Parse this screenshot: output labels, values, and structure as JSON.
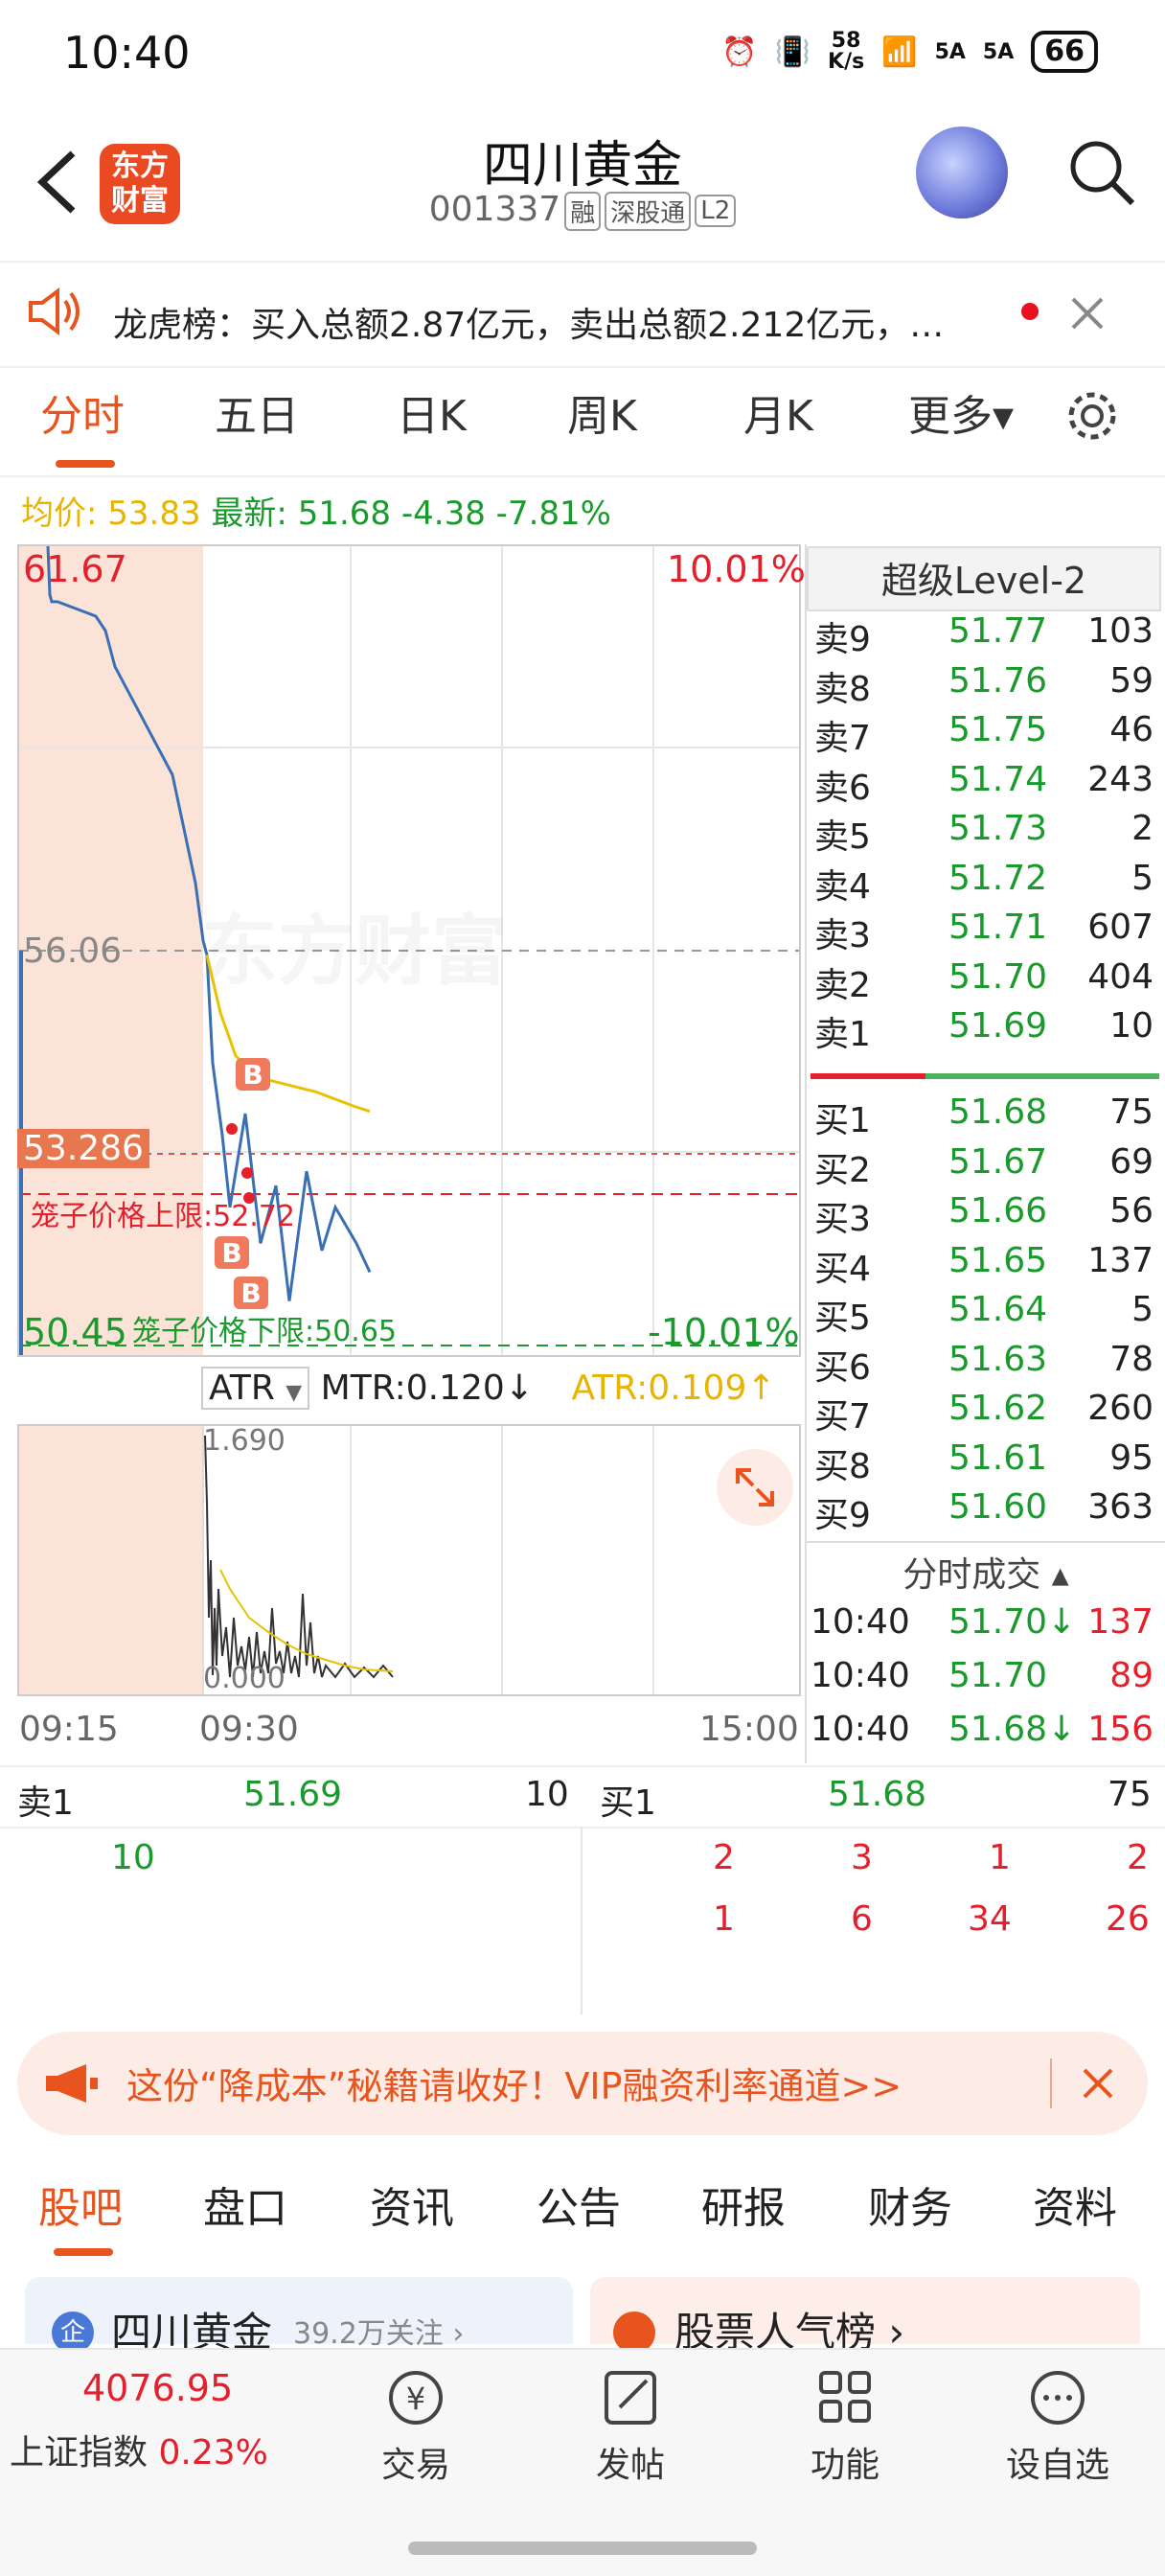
{
  "status_bar": {
    "time": "10:40",
    "net_speed": "58\nK/s",
    "signal1": "5A",
    "signal2": "5A",
    "battery": "66"
  },
  "header": {
    "logo": "东方\n财富",
    "title": "四川黄金",
    "code": "001337",
    "tags": [
      "融",
      "深股通",
      "L2"
    ]
  },
  "notice": {
    "text": "龙虎榜：买入总额2.87亿元，卖出总额2.212亿元，…"
  },
  "tabs": [
    "分时",
    "五日",
    "日K",
    "周K",
    "月K",
    "更多▾"
  ],
  "price_info": {
    "avg_label": "均价:",
    "avg_value": "53.83",
    "latest_label": "最新:",
    "latest_value": "51.68",
    "change": "-4.38",
    "pct": "-7.81%"
  },
  "chart": {
    "max_label": "61.67",
    "max_pct": "10.01%",
    "prev_close": "56.06",
    "current_label": "53.286",
    "min_label": "50.45",
    "min_pct": "-10.01%",
    "cage_upper": "笼子价格上限:52.72",
    "cage_lower": "笼子价格下限:50.65",
    "watermark": "东方财富",
    "b_marks": [
      "B",
      "B",
      "B"
    ]
  },
  "chart_data": {
    "type": "line",
    "title": "",
    "ylim": [
      50.45,
      61.67
    ],
    "series": [
      {
        "values": [
          61.67,
          61.0,
          60.9,
          60.9,
          60.8,
          60.7,
          60.5,
          60.0,
          59.5,
          58.5,
          57.0,
          56.2,
          56.0,
          54.5,
          53.5,
          52.5,
          53.8,
          52.0,
          52.8,
          51.2,
          53.0,
          51.9,
          52.5,
          52.0,
          51.6
        ]
      },
      {
        "values": [
          56.0,
          55.2,
          54.6,
          54.3,
          54.2,
          54.1,
          54.0,
          53.9,
          53.83
        ]
      }
    ]
  },
  "indicator": {
    "name": "ATR",
    "mtr": "MTR:0.120↓",
    "atr": "ATR:0.109↑",
    "max": "1.690",
    "min": "0.000"
  },
  "time_axis": [
    "09:15",
    "09:30",
    "15:00"
  ],
  "order_book": {
    "title": "超级Level-2",
    "sell": [
      {
        "label": "卖9",
        "price": "51.77",
        "vol": "103"
      },
      {
        "label": "卖8",
        "price": "51.76",
        "vol": "59"
      },
      {
        "label": "卖7",
        "price": "51.75",
        "vol": "46"
      },
      {
        "label": "卖6",
        "price": "51.74",
        "vol": "243"
      },
      {
        "label": "卖5",
        "price": "51.73",
        "vol": "2"
      },
      {
        "label": "卖4",
        "price": "51.72",
        "vol": "5"
      },
      {
        "label": "卖3",
        "price": "51.71",
        "vol": "607"
      },
      {
        "label": "卖2",
        "price": "51.70",
        "vol": "404"
      },
      {
        "label": "卖1",
        "price": "51.69",
        "vol": "10"
      }
    ],
    "buy": [
      {
        "label": "买1",
        "price": "51.68",
        "vol": "75"
      },
      {
        "label": "买2",
        "price": "51.67",
        "vol": "69"
      },
      {
        "label": "买3",
        "price": "51.66",
        "vol": "56"
      },
      {
        "label": "买4",
        "price": "51.65",
        "vol": "137"
      },
      {
        "label": "买5",
        "price": "51.64",
        "vol": "5"
      },
      {
        "label": "买6",
        "price": "51.63",
        "vol": "78"
      },
      {
        "label": "买7",
        "price": "51.62",
        "vol": "260"
      },
      {
        "label": "买8",
        "price": "51.61",
        "vol": "95"
      },
      {
        "label": "买9",
        "price": "51.60",
        "vol": "363"
      }
    ],
    "trades_title": "分时成交 ▴",
    "trades": [
      {
        "time": "10:40",
        "price": "51.70↓",
        "vol": "137"
      },
      {
        "time": "10:40",
        "price": "51.70",
        "vol": "89"
      },
      {
        "time": "10:40",
        "price": "51.68↓",
        "vol": "156"
      }
    ]
  },
  "queue": {
    "sell_label": "卖1",
    "sell_price": "51.69",
    "sell_vol": "10",
    "buy_label": "买1",
    "buy_price": "51.68",
    "buy_vol": "75",
    "sell_orders": [
      "10"
    ],
    "buy_orders_row1": [
      "2",
      "3",
      "1",
      "2"
    ],
    "buy_orders_row2": [
      "1",
      "6",
      "34",
      "26"
    ]
  },
  "banner": {
    "text": "这份“降成本”秘籍请收好！VIP融资利率通道>>"
  },
  "sub_tabs": [
    "股吧",
    "盘口",
    "资讯",
    "公告",
    "研报",
    "财务",
    "资料"
  ],
  "cards": {
    "left_title": "四川黄金",
    "left_sub": "39.2万关注 ›",
    "right_title": "股票人气榜 ›"
  },
  "bottom_nav": {
    "index_value": "4076.95",
    "index_name": "上证指数",
    "index_pct": "0.23%",
    "items": [
      "交易",
      "发帖",
      "功能",
      "设自选"
    ]
  }
}
